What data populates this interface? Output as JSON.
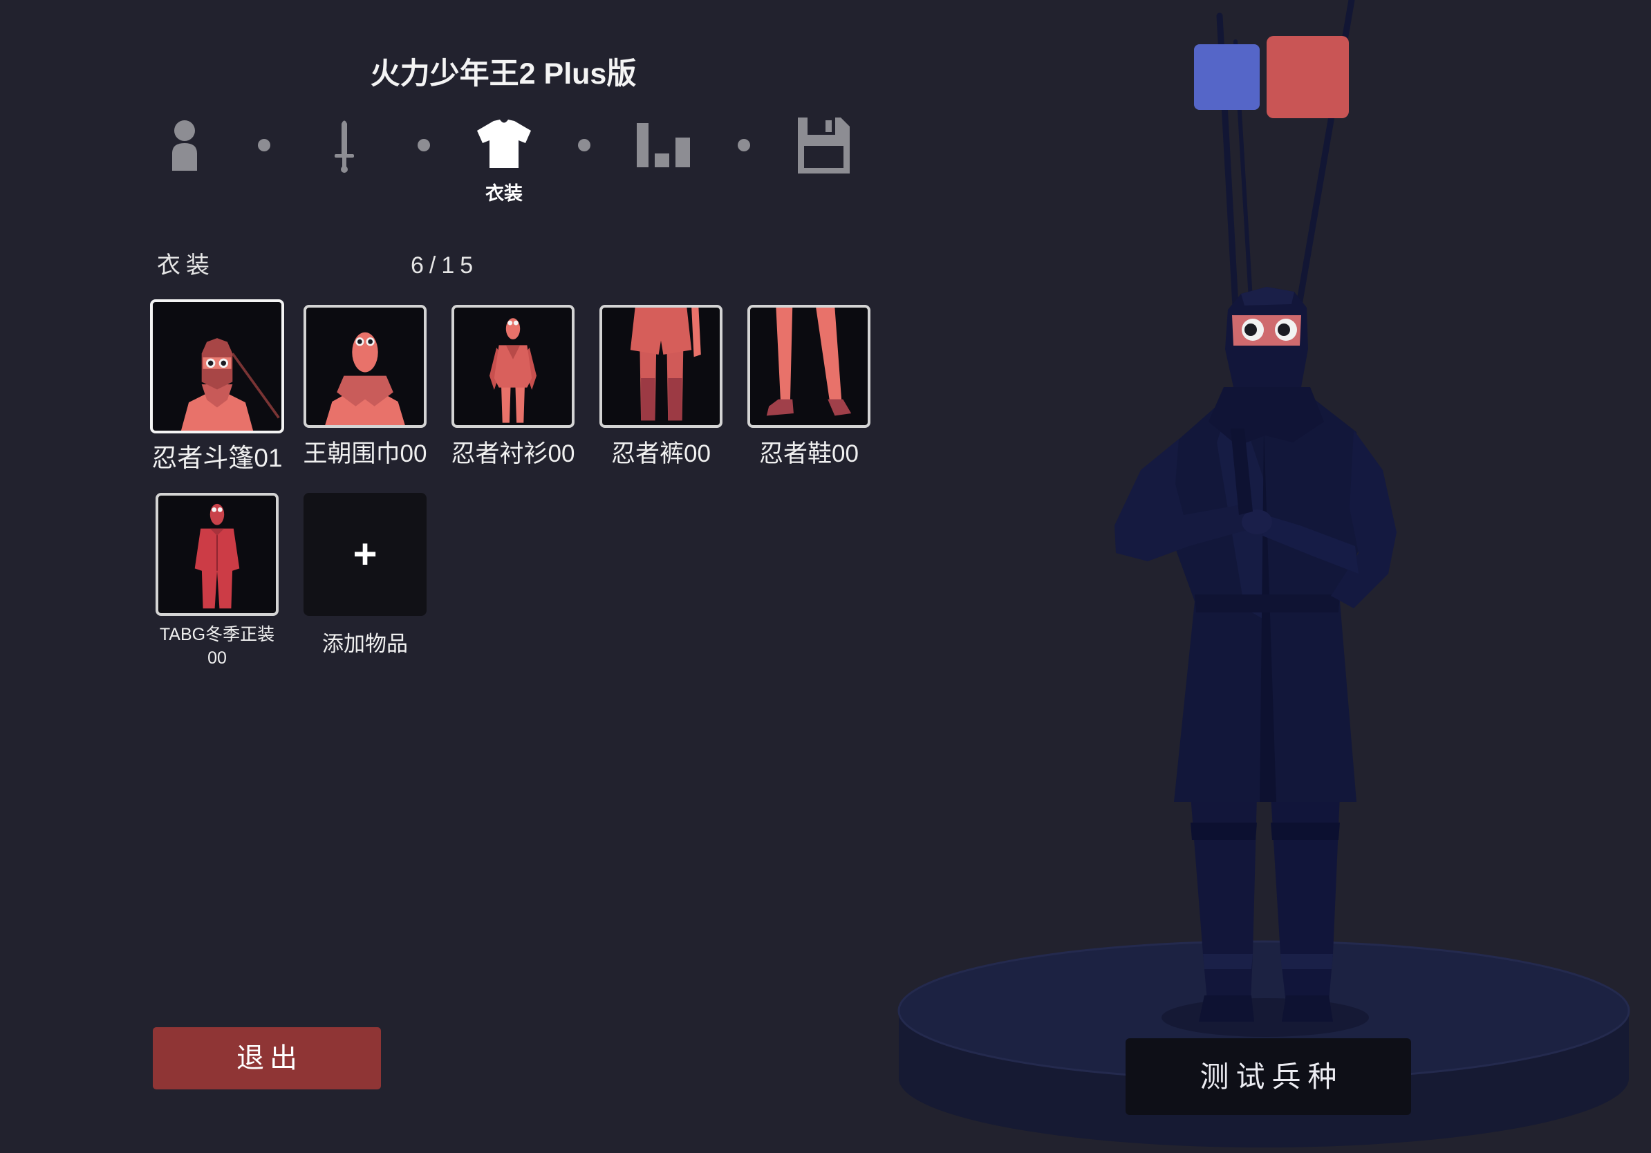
{
  "app": {
    "title": "火力少年王2 Plus版"
  },
  "steps": [
    {
      "icon": "person-icon"
    },
    {
      "icon": "sword-icon"
    },
    {
      "icon": "shirt-icon",
      "label": "衣装",
      "active": true
    },
    {
      "icon": "bar-chart-icon"
    },
    {
      "icon": "floppy-disk-icon"
    }
  ],
  "section": {
    "title": "衣装",
    "count": "6/15"
  },
  "items": [
    {
      "label": "忍者斗篷01",
      "selected": true
    },
    {
      "label": "王朝围巾00"
    },
    {
      "label": "忍者衬衫00"
    },
    {
      "label": "忍者裤00"
    },
    {
      "label": "忍者鞋00"
    },
    {
      "label": "TABG冬季正装00"
    }
  ],
  "add_item": {
    "label": "添加物品",
    "icon": "plus-icon",
    "symbol": "+"
  },
  "buttons": {
    "exit": "退出",
    "test_unit": "测试兵种"
  },
  "colors": {
    "background": "#22222e",
    "exit_button": "#8f3535",
    "team_blue": "#5566c8",
    "team_red": "#c95555"
  }
}
